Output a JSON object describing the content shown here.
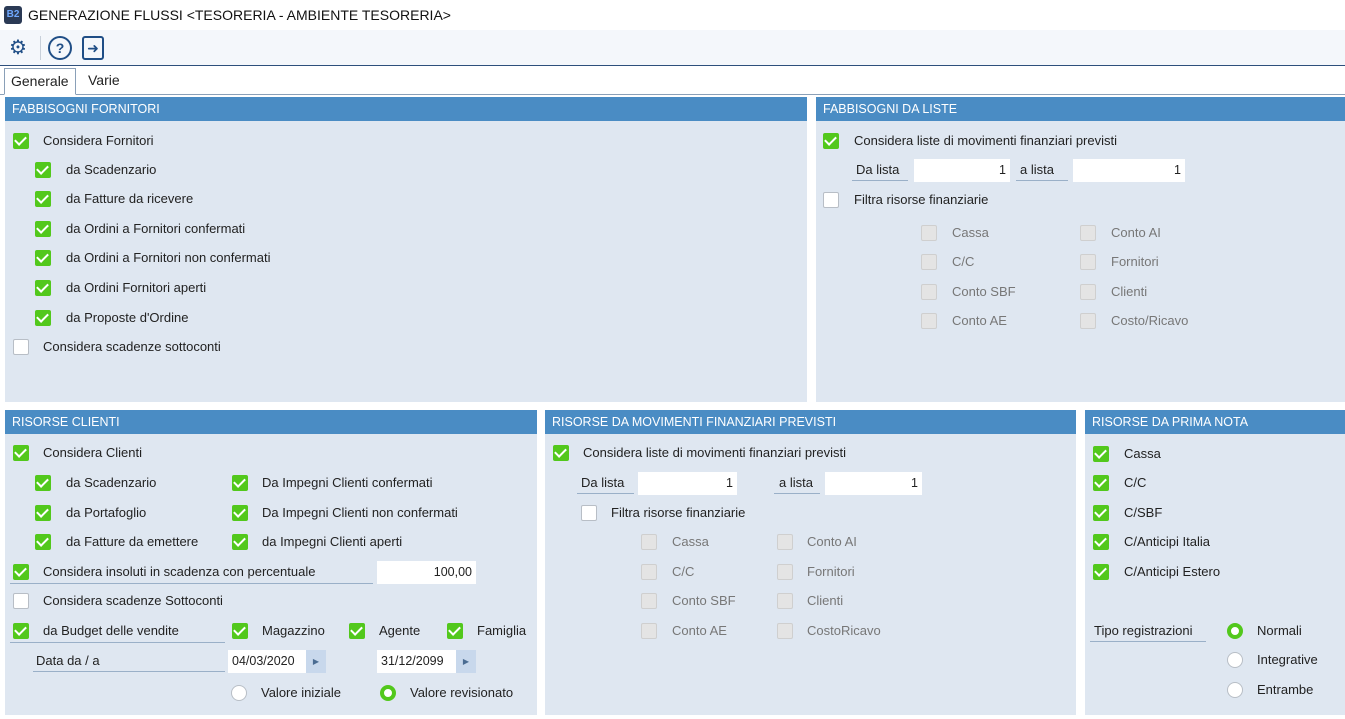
{
  "window": {
    "title": "GENERAZIONE FLUSSI <TESORERIA - AMBIENTE TESORERIA>",
    "logo": "B2"
  },
  "toolbar": {
    "icons": [
      "gears-icon",
      "help-icon",
      "exit-icon"
    ],
    "gear": "⚙",
    "help": "?",
    "exit": "➜"
  },
  "tabs": [
    {
      "label": "Generale",
      "active": true
    },
    {
      "label": "Varie",
      "active": false
    }
  ],
  "fabbisogni_fornitori": {
    "header": "FABBISOGNI FORNITORI",
    "items": [
      {
        "label": "Considera Fornitori",
        "checked": true
      },
      {
        "label": "da Scadenzario",
        "checked": true
      },
      {
        "label": "da Fatture da ricevere",
        "checked": true
      },
      {
        "label": "da Ordini a Fornitori confermati",
        "checked": true
      },
      {
        "label": "da Ordini a Fornitori non confermati",
        "checked": true
      },
      {
        "label": "da Ordini Fornitori aperti",
        "checked": true
      },
      {
        "label": "da Proposte d'Ordine",
        "checked": true
      },
      {
        "label": "Considera scadenze sottoconti",
        "checked": false
      }
    ]
  },
  "fabbisogni_liste": {
    "header": "FABBISOGNI DA LISTE",
    "considera": {
      "label": "Considera liste di movimenti finanziari previsti",
      "checked": true
    },
    "da_lista_label": "Da lista",
    "da_lista_value": "1",
    "a_lista_label": "a lista",
    "a_lista_value": "1",
    "filtra": {
      "label": "Filtra risorse finanziarie",
      "checked": false
    },
    "risorse": [
      {
        "label": "Cassa",
        "checked": false
      },
      {
        "label": "C/C",
        "checked": false
      },
      {
        "label": "Conto SBF",
        "checked": false
      },
      {
        "label": "Conto AE",
        "checked": false
      },
      {
        "label": "Conto AI",
        "checked": false
      },
      {
        "label": "Fornitori",
        "checked": false
      },
      {
        "label": "Clienti",
        "checked": false
      },
      {
        "label": "Costo/Ricavo",
        "checked": false
      }
    ]
  },
  "risorse_clienti": {
    "header": "RISORSE CLIENTI",
    "considera": {
      "label": "Considera Clienti",
      "checked": true
    },
    "items": [
      {
        "label": "da Scadenzario",
        "checked": true
      },
      {
        "label": "da Portafoglio",
        "checked": true
      },
      {
        "label": "da Fatture da emettere",
        "checked": true
      },
      {
        "label": "Da Impegni Clienti confermati",
        "checked": true
      },
      {
        "label": "Da Impegni Clienti non confermati",
        "checked": true
      },
      {
        "label": "da Impegni Clienti aperti",
        "checked": true
      }
    ],
    "insoluti": {
      "label": "Considera insoluti in scadenza con percentuale",
      "checked": true,
      "value": "100,00"
    },
    "scadenze": {
      "label": "Considera scadenze Sottoconti",
      "checked": false
    },
    "budget": {
      "label": "da Budget delle vendite",
      "checked": true
    },
    "magazzino": {
      "label": "Magazzino",
      "checked": true
    },
    "agente": {
      "label": "Agente",
      "checked": true
    },
    "famiglia": {
      "label": "Famiglia",
      "checked": true
    },
    "data_label": "Data da / a",
    "data_da": "04/03/2020",
    "data_a": "31/12/2099",
    "valore": [
      {
        "label": "Valore iniziale",
        "selected": false
      },
      {
        "label": "Valore revisionato",
        "selected": true
      }
    ]
  },
  "risorse_movimenti": {
    "header": "RISORSE DA MOVIMENTI FINANZIARI PREVISTI",
    "considera": {
      "label": "Considera liste di movimenti finanziari previsti",
      "checked": true
    },
    "da_lista_label": "Da lista",
    "da_lista_value": "1",
    "a_lista_label": "a lista",
    "a_lista_value": "1",
    "filtra": {
      "label": "Filtra risorse finanziarie",
      "checked": false
    },
    "risorse": [
      {
        "label": "Cassa",
        "checked": false
      },
      {
        "label": "C/C",
        "checked": false
      },
      {
        "label": "Conto SBF",
        "checked": false
      },
      {
        "label": "Conto AE",
        "checked": false
      },
      {
        "label": "Conto AI",
        "checked": false
      },
      {
        "label": "Fornitori",
        "checked": false
      },
      {
        "label": "Clienti",
        "checked": false
      },
      {
        "label": "CostoRicavo",
        "checked": false
      }
    ]
  },
  "risorse_prima_nota": {
    "header": "RISORSE DA PRIMA NOTA",
    "items": [
      {
        "label": "Cassa",
        "checked": true
      },
      {
        "label": "C/C",
        "checked": true
      },
      {
        "label": "C/SBF",
        "checked": true
      },
      {
        "label": "C/Anticipi Italia",
        "checked": true
      },
      {
        "label": "C/Anticipi Estero",
        "checked": true
      }
    ],
    "tipo_label": "Tipo registrazioni",
    "tipo": [
      {
        "label": "Normali",
        "selected": true
      },
      {
        "label": "Integrative",
        "selected": false
      },
      {
        "label": "Entrambe",
        "selected": false
      }
    ]
  }
}
